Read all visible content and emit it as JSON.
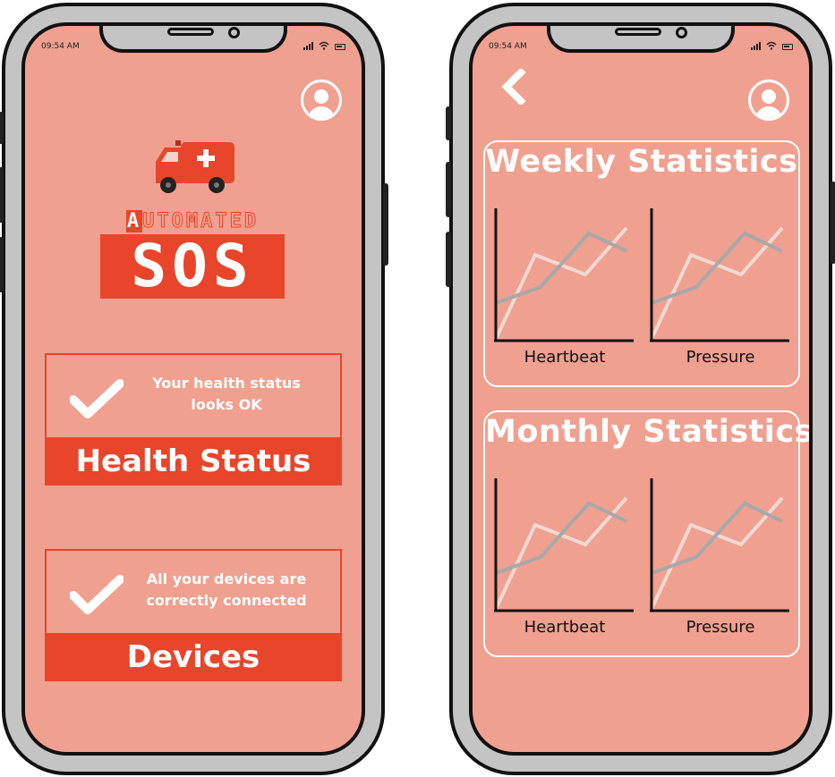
{
  "left_phone": {
    "status_bar": {
      "time": "09:54 AM"
    },
    "logo": {
      "top_word": "AUTOMATED",
      "main_word": "SOS"
    },
    "health_card": {
      "message_line1": "Your health status",
      "message_line2": "looks OK",
      "title": "Health Status"
    },
    "devices_card": {
      "message_line1": "All your devices are",
      "message_line2": "correctly connected",
      "title": "Devices"
    }
  },
  "right_phone": {
    "status_bar": {
      "time": "09:54 AM"
    },
    "weekly": {
      "title": "Weekly Statistics",
      "charts": [
        {
          "label": "Heartbeat"
        },
        {
          "label": "Pressure"
        }
      ]
    },
    "monthly": {
      "title": "Monthly Statistics",
      "charts": [
        {
          "label": "Heartbeat"
        },
        {
          "label": "Pressure"
        }
      ]
    }
  },
  "colors": {
    "screen_bg": "#f0a090",
    "accent_red": "#e8452a",
    "white": "#ffffff",
    "frame_gray": "#c4c4c4",
    "series_light": "#f2d8d2",
    "series_gray": "#a8a8a8"
  },
  "icons": [
    "ambulance-icon",
    "user-avatar-icon",
    "checkmark-icon",
    "back-chevron-icon",
    "signal-icon",
    "wifi-icon",
    "battery-icon"
  ]
}
